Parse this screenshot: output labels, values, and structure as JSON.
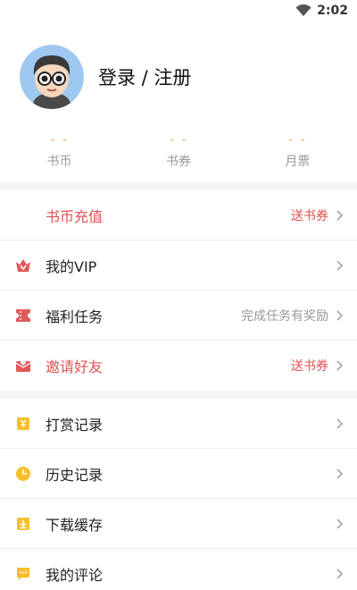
{
  "status": {
    "time": "2:02",
    "wifi_icon": "wifi-icon"
  },
  "profile": {
    "login_label": "登录 / 注册",
    "avatar_icon": "avatar"
  },
  "stats": [
    {
      "value": "- -",
      "label": "书币"
    },
    {
      "value": "- -",
      "label": "书券"
    },
    {
      "value": "- -",
      "label": "月票"
    }
  ],
  "menu_group1": [
    {
      "label": "书币充值",
      "tag": "送书券",
      "highlight": true,
      "icon": ""
    },
    {
      "label": "我的VIP",
      "tag": "",
      "highlight": false,
      "icon": "vip-icon"
    },
    {
      "label": "福利任务",
      "tag": "完成任务有奖励",
      "highlight": false,
      "icon": "ticket-icon"
    },
    {
      "label": "邀请好友",
      "tag": "送书券",
      "highlight": true,
      "icon": "envelope-heart-icon"
    }
  ],
  "menu_group2": [
    {
      "label": "打赏记录",
      "icon": "reward-icon"
    },
    {
      "label": "历史记录",
      "icon": "clock-icon"
    },
    {
      "label": "下载缓存",
      "icon": "download-icon"
    },
    {
      "label": "我的评论",
      "icon": "comment-icon"
    }
  ],
  "colors": {
    "accent_red": "#e05252",
    "stat_orange": "#f3a15c",
    "icon_yellow": "#f6c02a"
  }
}
